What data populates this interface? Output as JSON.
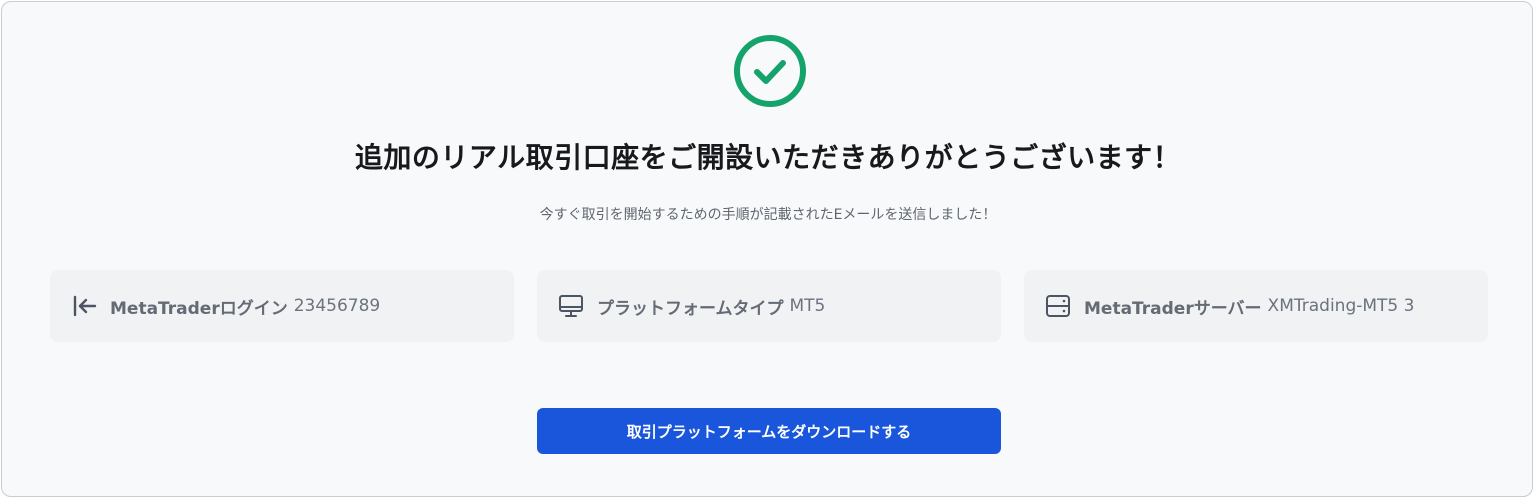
{
  "success": {
    "icon": "check-circle-icon",
    "color": "#14a36b",
    "title": "追加のリアル取引口座をご開設いただきありがとうございます！",
    "subtitle": "今すぐ取引を開始するための手順が記載されたEメールを送信しました！"
  },
  "account_info": [
    {
      "icon": "login-arrow-icon",
      "label": "MetaTraderログイン",
      "value": "23456789"
    },
    {
      "icon": "desktop-monitor-icon",
      "label": "プラットフォームタイプ",
      "value": "MT5"
    },
    {
      "icon": "server-icon",
      "label": "MetaTraderサーバー",
      "value": "XMTrading-MT5 3"
    }
  ],
  "download_button": {
    "label": "取引プラットフォームをダウンロードする",
    "color": "#1a56db"
  }
}
